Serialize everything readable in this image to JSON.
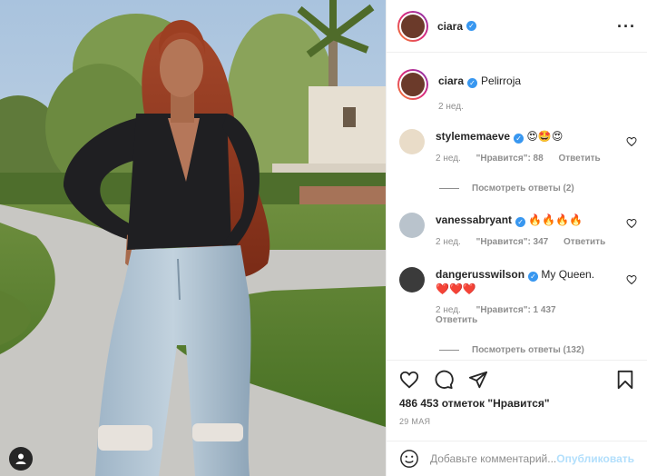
{
  "post": {
    "author": "ciara",
    "caption_author": "ciara",
    "caption_text": "Pelirroja",
    "caption_age": "2 нед."
  },
  "comments": [
    {
      "user": "stylememaeve",
      "text": "😍🤩😍",
      "age": "2 нед.",
      "likes": "\"Нравится\": 88",
      "reply": "Ответить",
      "view_replies": "Посмотреть ответы (2)"
    },
    {
      "user": "vanessabryant",
      "text": "🔥🔥🔥🔥",
      "age": "2 нед.",
      "likes": "\"Нравится\": 347",
      "reply": "Ответить"
    },
    {
      "user": "dangerusswilson",
      "text": "My Queen.",
      "text2": "❤️❤️❤️",
      "age": "2 нед.",
      "likes": "\"Нравится\": 1 437",
      "reply": "Ответить",
      "view_replies": "Посмотреть ответы (132)"
    }
  ],
  "actions": {
    "like_icon": "heart-icon",
    "comment_icon": "comment-icon",
    "share_icon": "share-icon",
    "save_icon": "bookmark-icon"
  },
  "likes_text": "486 453 отметок \"Нравится\"",
  "date": "29 МАЯ",
  "add_comment": {
    "placeholder": "Добавьте комментарий...",
    "post_button": "Опубликовать"
  },
  "colors": {
    "verified": "#3897f0",
    "post_button_disabled": "#b2dffc",
    "muted": "#8e8e8e"
  }
}
